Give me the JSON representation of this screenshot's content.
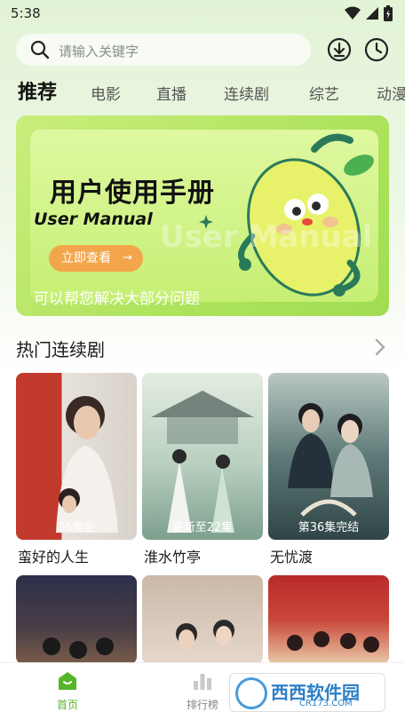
{
  "status_bar": {
    "time": "5:38"
  },
  "search": {
    "placeholder": "请输入关键字"
  },
  "category_tabs": [
    "推荐",
    "电影",
    "直播",
    "连续剧",
    "综艺",
    "动漫"
  ],
  "banner": {
    "title": "用户使用手册",
    "subtitle": "User Manual",
    "button_label": "立即查看",
    "button_arrow": "→",
    "caption": "可以帮您解决大部分问题",
    "watermark": "User Manual"
  },
  "section": {
    "title": "热门连续剧"
  },
  "shows": [
    {
      "title": "蛮好的人生",
      "episode": "36集全",
      "poster_colors": [
        "#c23a2e",
        "#e7e2dc"
      ]
    },
    {
      "title": "淮水竹亭",
      "episode": "更新至22集",
      "poster_colors": [
        "#9cb8a6",
        "#d9e3d7"
      ]
    },
    {
      "title": "无忧渡",
      "episode": "第36集完结",
      "poster_colors": [
        "#3c5a5e",
        "#b8c9c0"
      ]
    }
  ],
  "shows_row2": [
    {
      "poster_colors": [
        "#2d2f4a",
        "#7a5c4a"
      ]
    },
    {
      "poster_colors": [
        "#d9c6b8",
        "#f0e5da"
      ]
    },
    {
      "poster_colors": [
        "#b82a2a",
        "#e9c9a8"
      ]
    }
  ],
  "bottom_nav": [
    {
      "label": "首页",
      "icon": "home-icon",
      "active": true
    },
    {
      "label": "排行榜",
      "icon": "ranking-icon",
      "active": false
    }
  ],
  "site_watermark": {
    "text": "西西软件园",
    "sub": "CR173.COM"
  },
  "colors": {
    "accent": "#57b52b",
    "banner_button": "#f2a54a"
  }
}
